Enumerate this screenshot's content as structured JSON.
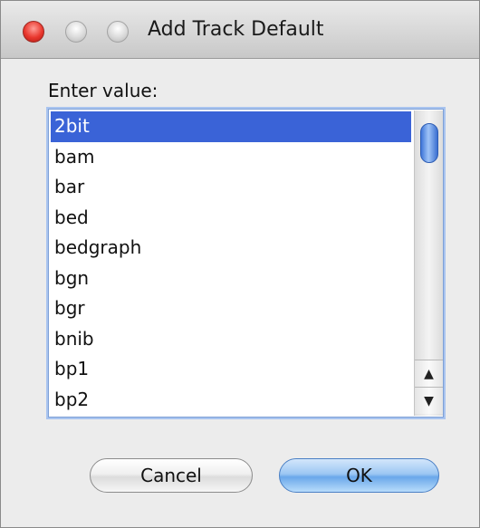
{
  "window": {
    "title": "Add Track Default"
  },
  "dialog": {
    "prompt_label": "Enter value:",
    "list_items": [
      "2bit",
      "bam",
      "bar",
      "bed",
      "bedgraph",
      "bgn",
      "bgr",
      "bnib",
      "bp1",
      "bp2"
    ],
    "selected_item": "2bit"
  },
  "scrollbar": {
    "up_arrow_glyph": "▲",
    "down_arrow_glyph": "▼"
  },
  "buttons": {
    "cancel_label": "Cancel",
    "ok_label": "OK"
  },
  "colors": {
    "selection": "#3a63d7",
    "close_light": "#e9372d",
    "default_button": "#6aa8ea"
  }
}
